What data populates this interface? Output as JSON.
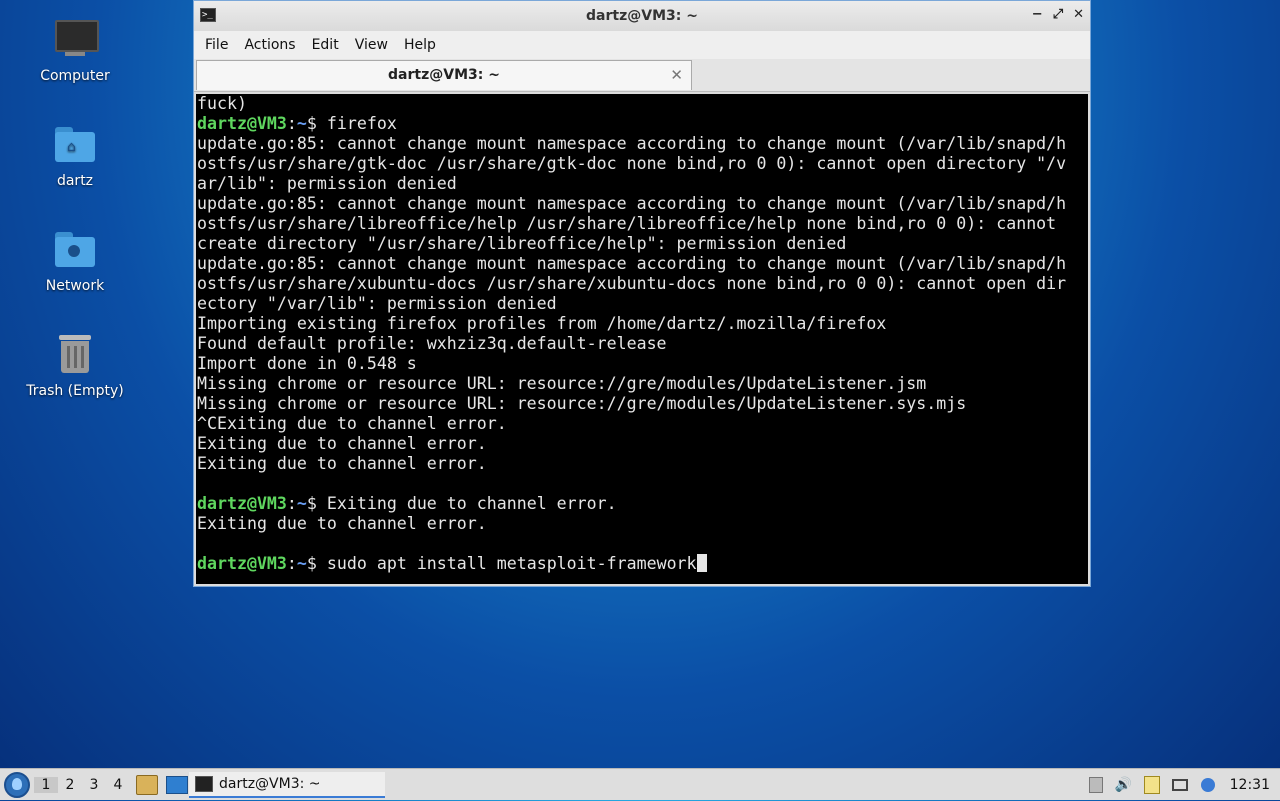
{
  "desktop": {
    "icons": [
      {
        "label": "Computer",
        "icon": "computer-icon"
      },
      {
        "label": "dartz",
        "icon": "home-folder-icon"
      },
      {
        "label": "Network",
        "icon": "network-folder-icon"
      },
      {
        "label": "Trash (Empty)",
        "icon": "trash-icon"
      }
    ]
  },
  "window": {
    "title": "dartz@VM3: ~",
    "controls": {
      "minimize": "−",
      "maximize": "⤢",
      "close": "✕"
    },
    "menu": [
      "File",
      "Actions",
      "Edit",
      "View",
      "Help"
    ],
    "tab": {
      "label": "dartz@VM3: ~",
      "close": "✕"
    }
  },
  "terminal": {
    "prompt_user": "dartz@VM3",
    "prompt_path": "~",
    "lines": [
      {
        "type": "out",
        "text": "fuck)"
      },
      {
        "type": "prompt",
        "cmd": "firefox"
      },
      {
        "type": "out",
        "text": "update.go:85: cannot change mount namespace according to change mount (/var/lib/snapd/h"
      },
      {
        "type": "out",
        "text": "ostfs/usr/share/gtk-doc /usr/share/gtk-doc none bind,ro 0 0): cannot open directory \"/v"
      },
      {
        "type": "out",
        "text": "ar/lib\": permission denied"
      },
      {
        "type": "out",
        "text": "update.go:85: cannot change mount namespace according to change mount (/var/lib/snapd/h"
      },
      {
        "type": "out",
        "text": "ostfs/usr/share/libreoffice/help /usr/share/libreoffice/help none bind,ro 0 0): cannot"
      },
      {
        "type": "out",
        "text": "create directory \"/usr/share/libreoffice/help\": permission denied"
      },
      {
        "type": "out",
        "text": "update.go:85: cannot change mount namespace according to change mount (/var/lib/snapd/h"
      },
      {
        "type": "out",
        "text": "ostfs/usr/share/xubuntu-docs /usr/share/xubuntu-docs none bind,ro 0 0): cannot open dir"
      },
      {
        "type": "out",
        "text": "ectory \"/var/lib\": permission denied"
      },
      {
        "type": "out",
        "text": "Importing existing firefox profiles from /home/dartz/.mozilla/firefox"
      },
      {
        "type": "out",
        "text": "Found default profile: wxhziz3q.default-release"
      },
      {
        "type": "out",
        "text": "Import done in 0.548 s"
      },
      {
        "type": "out",
        "text": "Missing chrome or resource URL: resource://gre/modules/UpdateListener.jsm"
      },
      {
        "type": "out",
        "text": "Missing chrome or resource URL: resource://gre/modules/UpdateListener.sys.mjs"
      },
      {
        "type": "out",
        "text": "^CExiting due to channel error."
      },
      {
        "type": "out",
        "text": "Exiting due to channel error."
      },
      {
        "type": "out",
        "text": "Exiting due to channel error."
      },
      {
        "type": "out",
        "text": ""
      },
      {
        "type": "prompt",
        "cmd": "Exiting due to channel error."
      },
      {
        "type": "out",
        "text": "Exiting due to channel error."
      },
      {
        "type": "out",
        "text": ""
      },
      {
        "type": "prompt",
        "cmd": "sudo apt install metasploit-framework",
        "cursor": true
      }
    ]
  },
  "taskbar": {
    "menu_icon": "xubuntu-menu-icon",
    "workspaces": [
      "1",
      "2",
      "3",
      "4"
    ],
    "active_workspace": "1",
    "task": {
      "label": "dartz@VM3: ~"
    },
    "clock": "12:31"
  }
}
